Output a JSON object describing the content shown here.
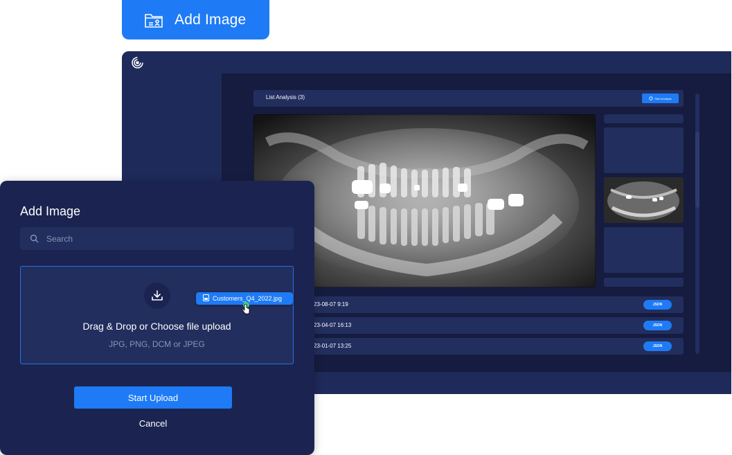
{
  "top_button": {
    "label": "Add Image",
    "icon": "folder-image-icon"
  },
  "app": {
    "list_title": "List Analysis (3)",
    "start_analysis_label": "Start Analysis",
    "rows": [
      {
        "date": "23-08-07 9:19",
        "button": "JSON"
      },
      {
        "date": "23-04-07 16:13",
        "button": "JSON"
      },
      {
        "date": "23-01-07 13:25",
        "button": "JSON"
      }
    ]
  },
  "modal": {
    "title": "Add Image",
    "search_placeholder": "Search",
    "dropzone_title": "Drag & Drop or Choose file upload",
    "dropzone_formats": "JPG, PNG, DCM or JPEG",
    "dragged_file": "Customers_Q4_2022.jpg",
    "start_upload_label": "Start Upload",
    "cancel_label": "Cancel"
  },
  "colors": {
    "accent": "#1e7bf5",
    "panel": "#1b2450",
    "surface": "#222e5e",
    "drag_indicator": "#3ccf7a"
  }
}
